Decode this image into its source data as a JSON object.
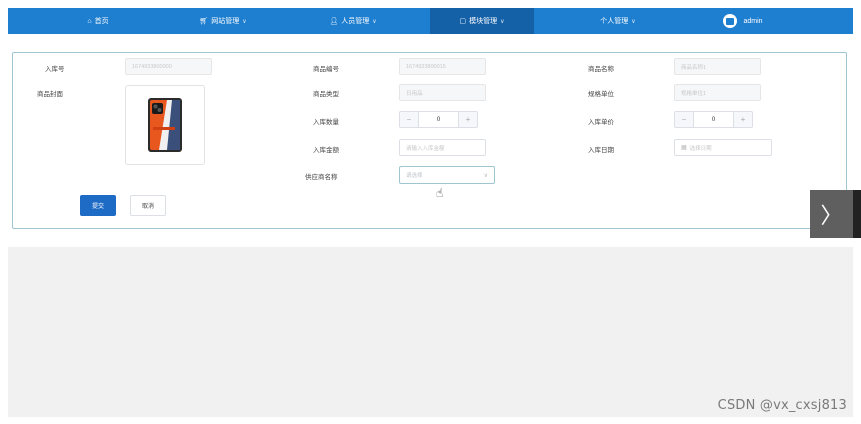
{
  "nav": {
    "home": "首页",
    "site_mgmt": "网站管理",
    "staff_mgmt": "人员管理",
    "module_mgmt": "模块管理",
    "personal_mgmt": "个人管理",
    "user": "admin"
  },
  "form": {
    "stock_no_label": "入库号",
    "stock_no_value": "1674933800000",
    "product_code_label": "商品编号",
    "product_code_value": "1674933800015",
    "product_name_label": "商品名称",
    "product_name_placeholder": "商品名称1",
    "cover_label": "商品封面",
    "product_type_label": "商品类型",
    "product_type_value": "日用品",
    "spec_unit_label": "规格单位",
    "spec_unit_placeholder": "规格单位1",
    "qty_label": "入库数量",
    "qty_value": "0",
    "unit_price_label": "入库单价",
    "unit_price_value": "0",
    "amount_label": "入库金额",
    "amount_placeholder": "请输入入库金额",
    "date_label": "入库日期",
    "date_placeholder": "选择日期",
    "supplier_label": "供应商名称",
    "supplier_placeholder": "请选择",
    "submit": "提交",
    "cancel": "取消"
  },
  "icons": {
    "home": "home-icon",
    "site": "cart-icon",
    "staff": "person-icon",
    "module": "module-icon",
    "calendar": "calendar-icon",
    "next": "chevron-right-icon"
  },
  "colors": {
    "nav_bg": "#1e7ecf",
    "nav_active": "#1561a8",
    "primary_button": "#1e6bc5",
    "panel_border": "#9fc6d0"
  },
  "watermark": "CSDN @vx_cxsj813"
}
